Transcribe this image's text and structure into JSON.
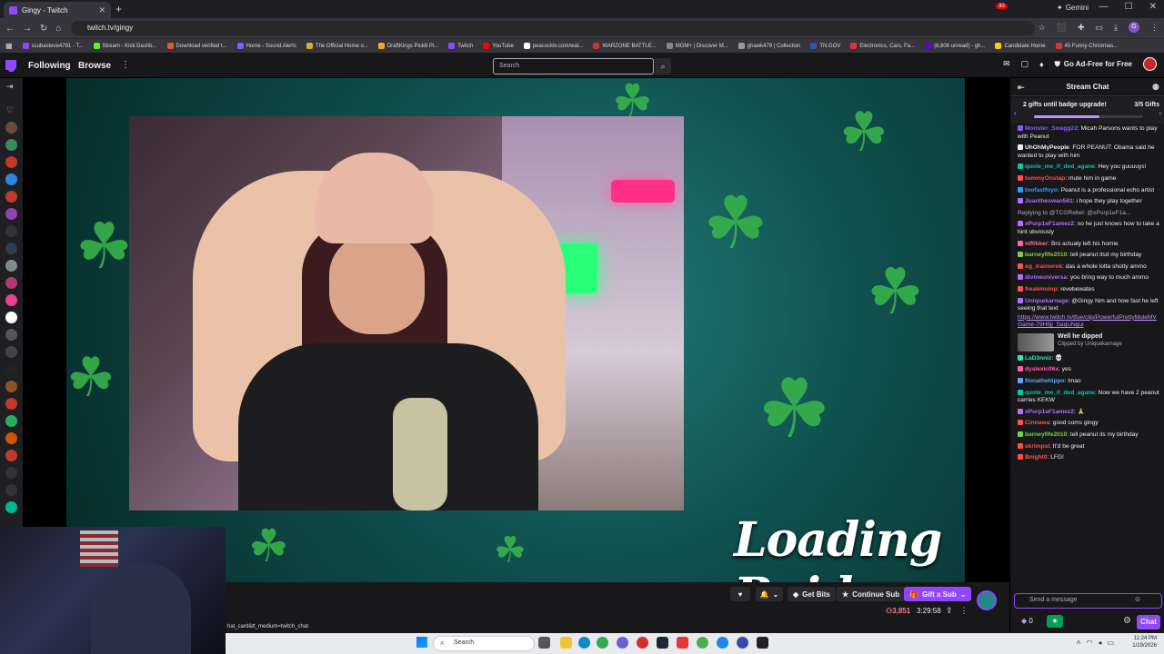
{
  "browser": {
    "tab_title": "Gingy - Twitch",
    "new_tab": "+",
    "gemini_label": "Gemini",
    "url": "twitch.tv/gingy",
    "window_controls": [
      "—",
      "☐",
      "✕"
    ],
    "bookmarks": [
      {
        "label": "scubasteve4761 - T...",
        "color": "#9147ff"
      },
      {
        "label": "Stream - Kick Dashb...",
        "color": "#53fc18"
      },
      {
        "label": "Download verified t...",
        "color": "#e05a2b"
      },
      {
        "label": "Home - Sound Alerts",
        "color": "#7b61ff"
      },
      {
        "label": "The Official Home o...",
        "color": "#d4af37"
      },
      {
        "label": "DraftKings Pick6 Pi...",
        "color": "#f7a823"
      },
      {
        "label": "Twitch",
        "color": "#9147ff"
      },
      {
        "label": "YouTube",
        "color": "#ff0000"
      },
      {
        "label": "peacocktv.com/wat...",
        "color": "#ffffff"
      },
      {
        "label": "WARZONE BATTLE...",
        "color": "#cc3333"
      },
      {
        "label": "MGM+ | Discover M...",
        "color": "#888888"
      },
      {
        "label": "ghawk479 | Collection",
        "color": "#999999"
      },
      {
        "label": "TN.GOV",
        "color": "#3355aa"
      },
      {
        "label": "Electronics, Cars, Fa...",
        "color": "#e53238"
      },
      {
        "label": "(8,606 unread) - gh...",
        "color": "#6001d2"
      },
      {
        "label": "Candidate Home",
        "color": "#ffcc00"
      },
      {
        "label": "45 Funny Christmas...",
        "color": "#dd3333"
      }
    ]
  },
  "topnav": {
    "following": "Following",
    "browse": "Browse",
    "more": "⋮",
    "search_placeholder": "Search",
    "notif_count": "30",
    "ad_free": "Go Ad-Free for Free"
  },
  "player": {
    "overlay_text": "Loading Raid.",
    "status_url": "hat_card&tt_medium=twitch_chat",
    "buttons": {
      "get_bits": "Get Bits",
      "continue_sub": "Continue Sub",
      "gift_sub": "Gift a Sub"
    },
    "viewers": "3,851",
    "uptime": "3:29:58"
  },
  "chat": {
    "header": "Stream Chat",
    "gift_banner": {
      "text": "2 gifts until badge upgrade!",
      "progress": "3/5 Gifts",
      "fraction": 0.6
    },
    "messages": [
      {
        "user": "Monster_Swagg22",
        "color": "#8a5cf6",
        "text": "Micah Parsons wants to play with Peanut"
      },
      {
        "user": "UhOhMyPeople",
        "color": "#efeff1",
        "text": "FOR PEANUT: Obama said he wanted to play with him"
      },
      {
        "user": "quote_me_if_ded_agane",
        "color": "#00c8af",
        "text": "Hey you guuuuys!"
      },
      {
        "user": "tommyOnstap",
        "color": "#ff4f4f",
        "text": "mute him in game"
      },
      {
        "user": "toofastfoyo",
        "color": "#2e9bff",
        "text": "Peanut is a professional echo artist"
      },
      {
        "user": "Juantheswan561",
        "color": "#b56dff",
        "text": "i hope they play together"
      },
      {
        "reply": "Replying to @TCGRebel: @xPurp1eF1a..."
      },
      {
        "user": "xPurp1eF1amez2",
        "color": "#b56dff",
        "text": "no he just knows how to take a hint obviously"
      },
      {
        "user": "nlf0kker",
        "color": "#ff6b9a",
        "text": "Bro actualy left his homie"
      },
      {
        "user": "barneyfife2010",
        "color": "#7ad04b",
        "text": "tell peanut itsd my birthday"
      },
      {
        "user": "og_trainwrek",
        "color": "#ff4f4f",
        "text": "das a whole lotta shotty ammo"
      },
      {
        "user": "divineuniversa",
        "color": "#b56dff",
        "text": "you bring way to much ammo"
      },
      {
        "user": "freakmoinp",
        "color": "#ff4f4f",
        "text": "revebewates"
      },
      {
        "user": "Uniquekarnage",
        "color": "#b56dff",
        "text": "@Gingy him and how fast he left seeing that text"
      },
      {
        "link": "https://www.twitch.tv/tfue/clip/PowerfulPrettyMuleMVGame-79H6jj_SaqUNgui"
      },
      {
        "clip_title": "Well he dipped",
        "clip_sub": "Clipped by Uniquekarnage"
      },
      {
        "user": "LaD3nniz",
        "color": "#2ee6a8",
        "text": "💀"
      },
      {
        "user": "dyslexic06x",
        "color": "#ff5fa8",
        "text": "yes"
      },
      {
        "user": "fionathehippo",
        "color": "#5fa8ff",
        "text": "lmao"
      },
      {
        "user": "quote_me_if_ded_agane",
        "color": "#00c8af",
        "text": "Now we have 2 peanut carries KEKW"
      },
      {
        "user": "xPurp1eF1amez2",
        "color": "#b56dff",
        "text": "🙏"
      },
      {
        "user": "Cinnawa",
        "color": "#ff4f4f",
        "text": "good coms gingy"
      },
      {
        "user": "barneyfife2010",
        "color": "#7ad04b",
        "text": "tell peanut its my birthday"
      },
      {
        "user": "skrimpsi",
        "color": "#ff4f4f",
        "text": "It'd be great"
      },
      {
        "user": "Bnight0",
        "color": "#ff4f4f",
        "text": "LFG!"
      }
    ],
    "input_placeholder": "Send a message",
    "bits_count": "0",
    "chat_button": "Chat"
  },
  "taskbar": {
    "search_placeholder": "Search",
    "time": "11:24 PM",
    "date": "1/19/2026"
  },
  "colors": {
    "twitch_purple": "#9147ff",
    "live_red": "#eb0400"
  }
}
